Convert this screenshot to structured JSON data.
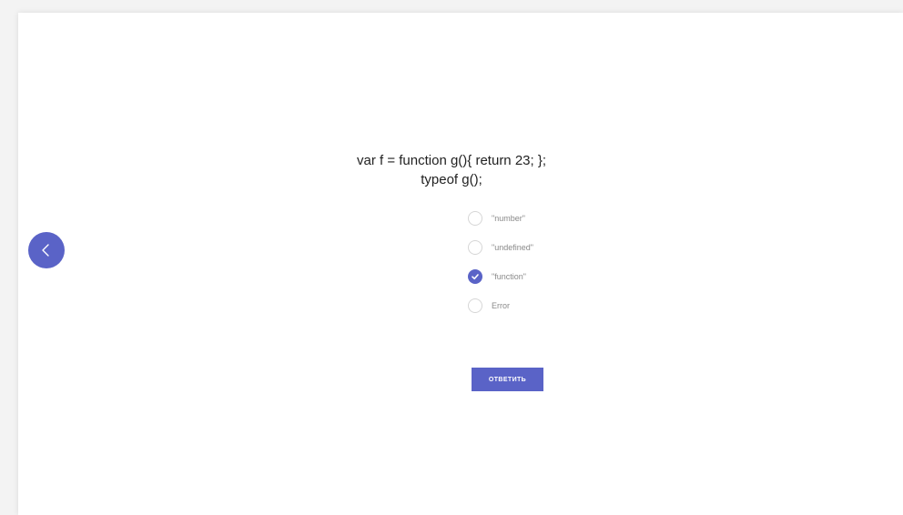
{
  "question": {
    "code_lines": [
      "var f = function g(){ return 23; };",
      "typeof g();"
    ]
  },
  "options": [
    {
      "label": "\"number\"",
      "selected": false
    },
    {
      "label": "\"undefined\"",
      "selected": false
    },
    {
      "label": "\"function\"",
      "selected": true
    },
    {
      "label": "Error",
      "selected": false
    }
  ],
  "submit_label": "ОТВЕТИТЬ",
  "colors": {
    "accent": "#5a63c7",
    "background": "#ffffff"
  },
  "icons": {
    "back": "chevron-left-icon",
    "checked": "check-icon"
  }
}
